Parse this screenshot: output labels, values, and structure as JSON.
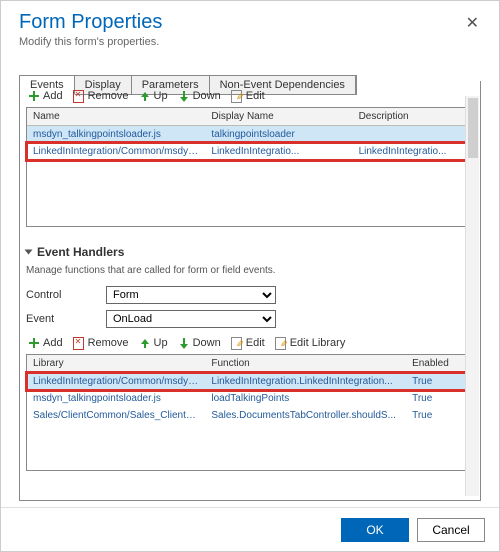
{
  "dialog": {
    "title": "Form Properties",
    "subtitle": "Modify this form's properties."
  },
  "tabs": {
    "items": [
      "Events",
      "Display",
      "Parameters",
      "Non-Event Dependencies"
    ],
    "active": 0
  },
  "webres_toolbar": {
    "add": "Add",
    "remove": "Remove",
    "up": "Up",
    "down": "Down",
    "edit": "Edit"
  },
  "webres_grid": {
    "cols": [
      "Name",
      "Display Name",
      "Description"
    ],
    "rows": [
      {
        "name": "msdyn_talkingpointsloader.js",
        "display": "talkingpointsloader",
        "desc": ""
      },
      {
        "name": "LinkedInIntegration/Common/msdyn_L...",
        "display": "LinkedInIntegratio...",
        "desc": "LinkedInIntegratio..."
      }
    ]
  },
  "handlers_section": {
    "title": "Event Handlers",
    "desc": "Manage functions that are called for form or field events.",
    "control_label": "Control",
    "event_label": "Event",
    "control_value": "Form",
    "event_value": "OnLoad"
  },
  "handlers_toolbar": {
    "add": "Add",
    "remove": "Remove",
    "up": "Up",
    "down": "Down",
    "edit": "Edit",
    "edit_library": "Edit Library"
  },
  "handlers_grid": {
    "cols": [
      "Library",
      "Function",
      "Enabled"
    ],
    "rows": [
      {
        "lib": "LinkedInIntegration/Common/msdyn_L...",
        "func": "LinkedInIntegration.LinkedInIntegration...",
        "enabled": "True"
      },
      {
        "lib": "msdyn_talkingpointsloader.js",
        "func": "loadTalkingPoints",
        "enabled": "True"
      },
      {
        "lib": "Sales/ClientCommon/Sales_ClientCom...",
        "func": "Sales.DocumentsTabController.shouldS...",
        "enabled": "True"
      }
    ]
  },
  "footer": {
    "ok": "OK",
    "cancel": "Cancel"
  }
}
